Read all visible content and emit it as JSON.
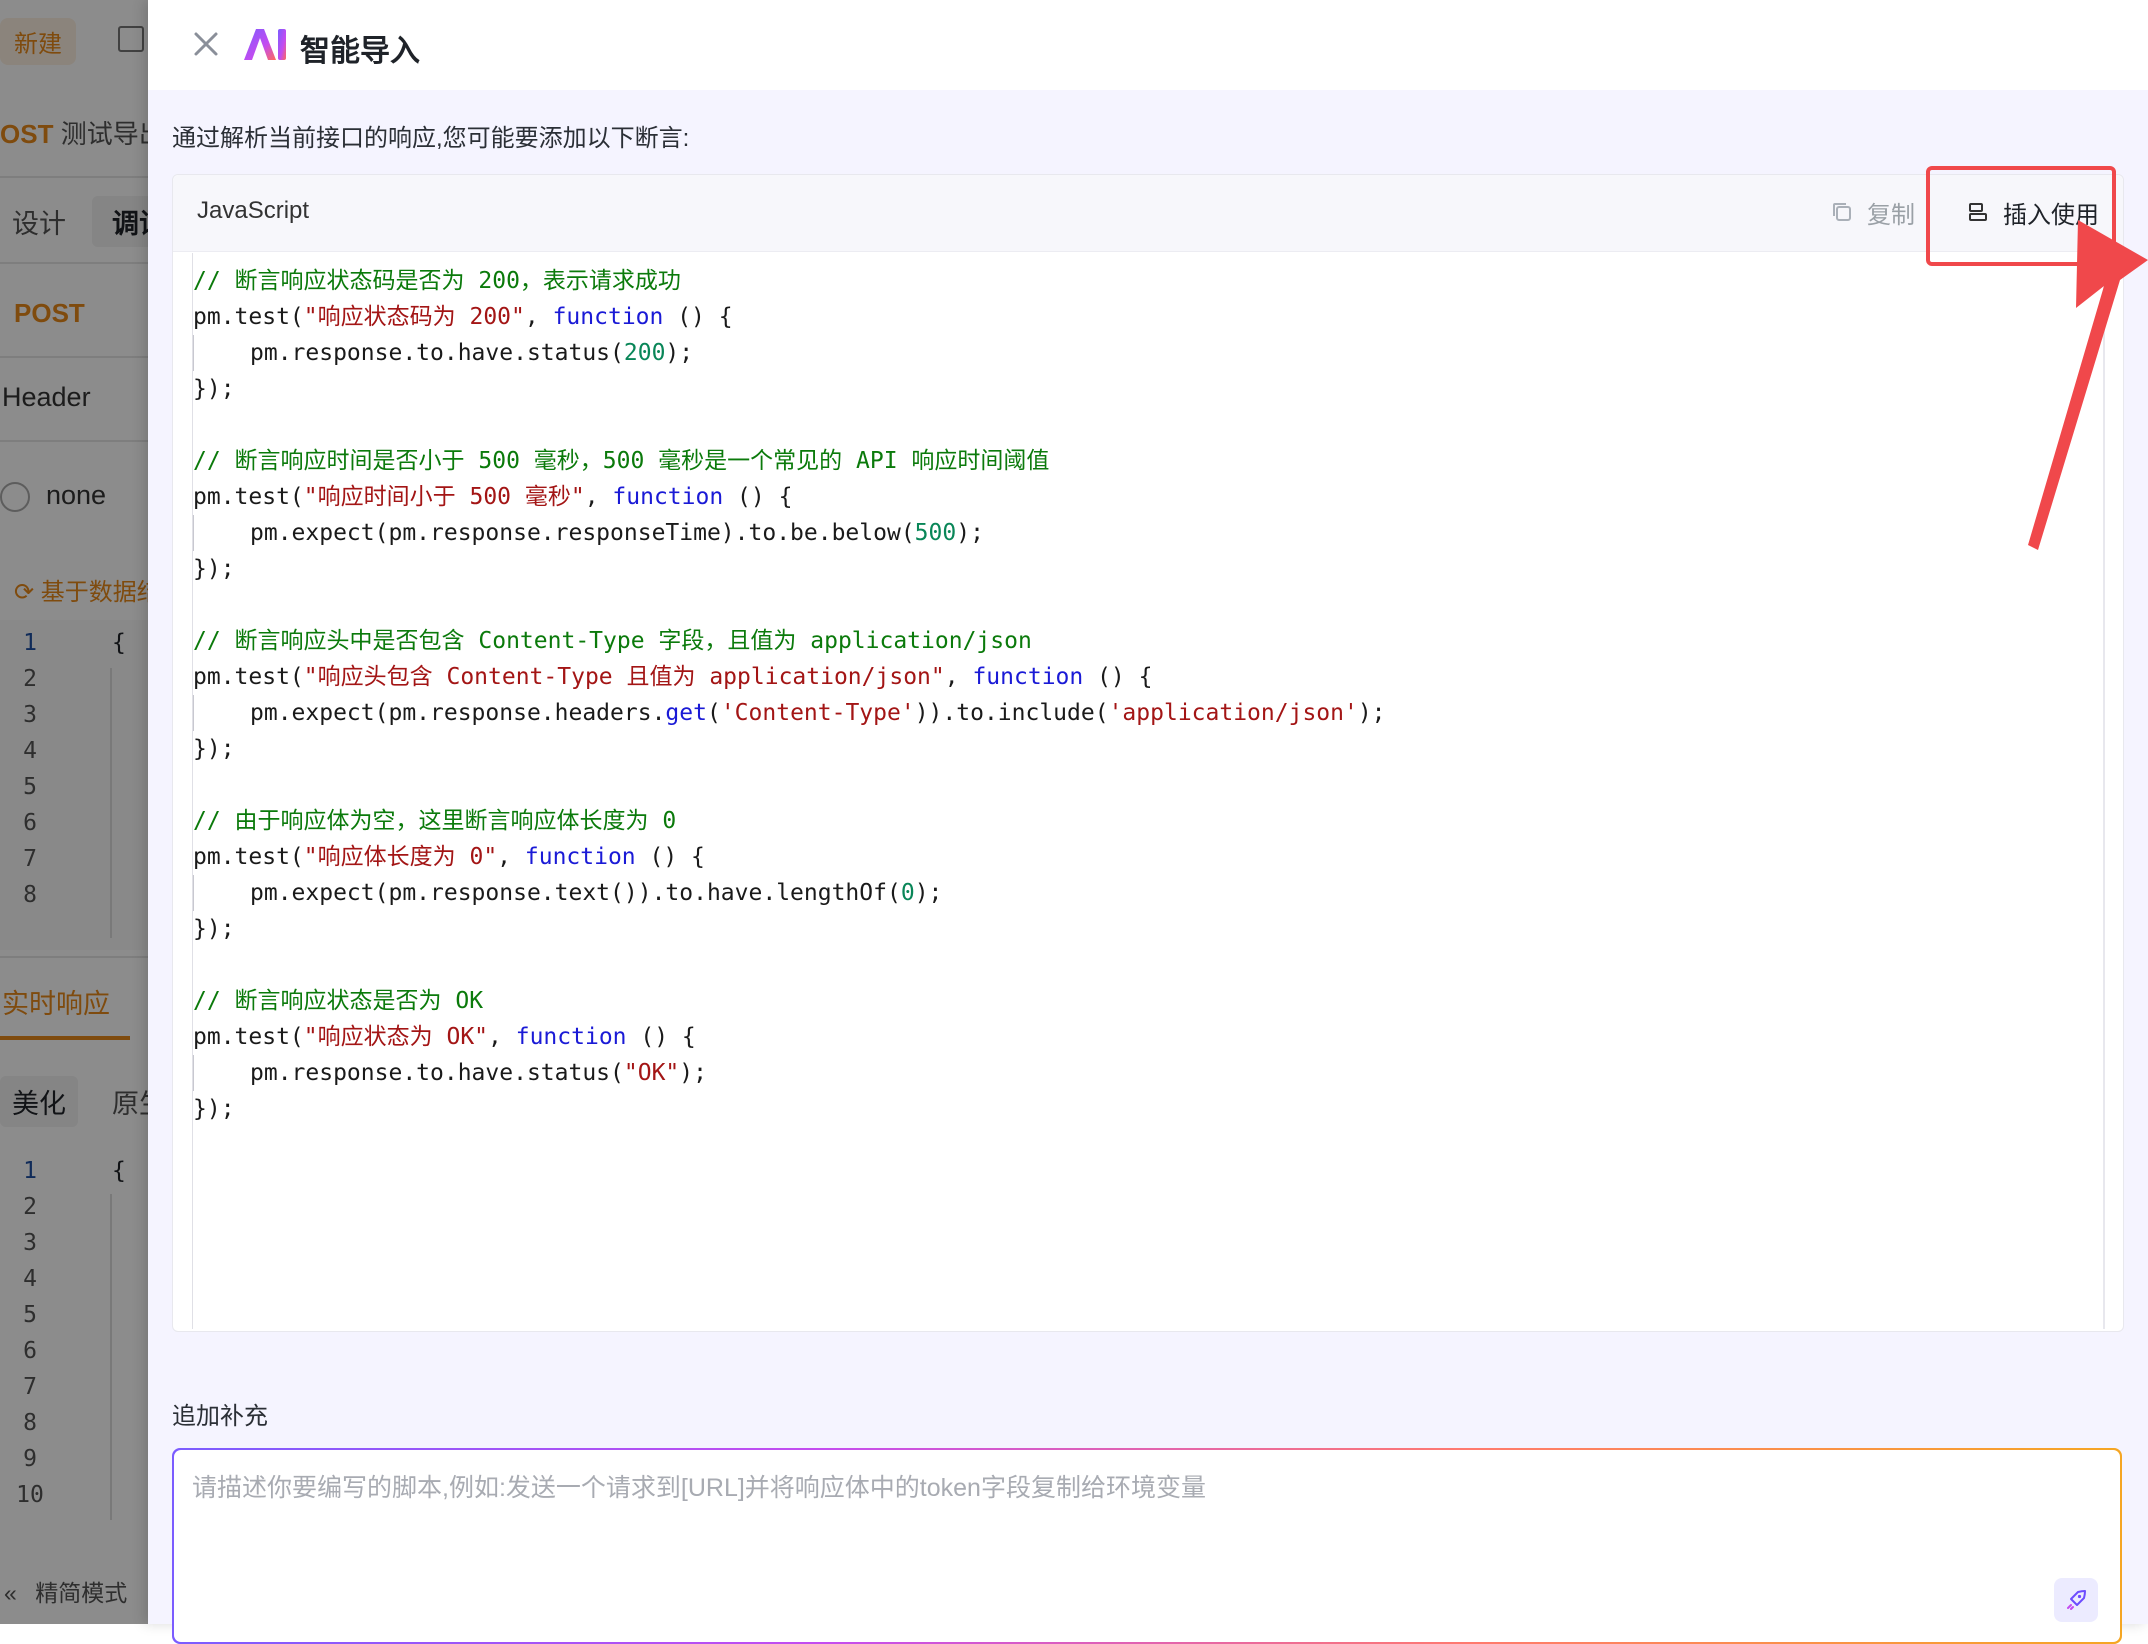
{
  "background_app": {
    "new_button": "新建",
    "request_title_prefix": "OST",
    "request_title": "测试导出",
    "tabs": [
      "设计",
      "调试"
    ],
    "method": "POST",
    "section_header": "Header",
    "radio_label": "none",
    "generate_link": "基于数据结",
    "editor1_line_numbers": [
      "1",
      "2",
      "3",
      "4",
      "5",
      "6",
      "7",
      "8"
    ],
    "editor1_first_line": "{",
    "response_tab": "实时响应",
    "view_tabs": [
      "美化",
      "原生"
    ],
    "editor2_line_numbers": [
      "1",
      "2",
      "3",
      "4",
      "5",
      "6",
      "7",
      "8",
      "9",
      "10"
    ],
    "editor2_first_line": "{",
    "footer_mode": "精简模式"
  },
  "drawer": {
    "title": "智能导入",
    "logo_text": "AI",
    "intro_text": "通过解析当前接口的响应,您可能要添加以下断言:",
    "code_block": {
      "language": "JavaScript",
      "copy_label": "复制",
      "insert_label": "插入使用"
    },
    "supplement_label": "追加补充",
    "prompt_placeholder": "请描述你要编写的脚本,例如:发送一个请求到[URL]并将响应体中的token字段复制给环境变量",
    "prompt_value": ""
  },
  "colors": {
    "accent_orange": "#e8891a",
    "highlight_red": "#f0484b",
    "comment_green": "#0b7a0b",
    "string_red": "#a31515",
    "keyword_blue": "#1a1ad6",
    "number_teal": "#098658",
    "panel_bg": "#f5f4ff"
  },
  "icons": {
    "close": "close-icon",
    "logo": "ai-logo-icon",
    "copy": "copy-icon",
    "insert": "insert-icon",
    "send": "rocket-send-icon",
    "refresh": "refresh-icon",
    "collapse": "double-chevron-left-icon"
  }
}
